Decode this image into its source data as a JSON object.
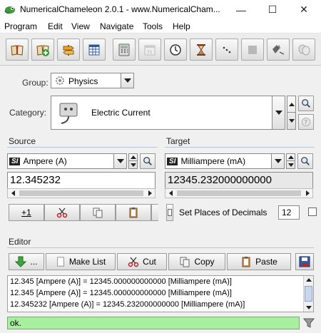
{
  "window": {
    "title": "NumericalChameleon 2.0.1 - www.NumericalCham...",
    "minimize_glyph": "—",
    "maximize_glyph": "☐",
    "close_glyph": "✕"
  },
  "menu": [
    "Program",
    "Edit",
    "View",
    "Navigate",
    "Tools",
    "Help"
  ],
  "toolbar": {
    "icons": [
      "book-icon",
      "add-book-icon",
      "signpost-icon",
      "table-icon",
      "calculator-icon",
      "calendar-icon",
      "clock-icon",
      "hourglass-icon",
      "dice-icon",
      "square-icon",
      "speech-icon",
      "masks-icon"
    ]
  },
  "group": {
    "label": "Group:",
    "value": "Physics"
  },
  "category": {
    "label": "Category:",
    "value": "Electric Current"
  },
  "source": {
    "title": "Source",
    "unit_badge": "SI",
    "unit": "Ampere (A)",
    "value": "12.345232"
  },
  "target": {
    "title": "Target",
    "unit_badge": "SI",
    "unit": "Milliampere (mA)",
    "value": "12345.232000000000"
  },
  "source_actions": {
    "increment_label": "+1"
  },
  "decimals": {
    "label": "Set Places of Decimals",
    "value": "12"
  },
  "editor": {
    "title": "Editor",
    "buttons": {
      "more_label": "...",
      "make_list": "Make List",
      "cut": "Cut",
      "copy": "Copy",
      "paste": "Paste"
    },
    "lines": [
      "12.345 [Ampere (A)] = 12345.000000000000 [Milliampere (mA)]",
      "12.345 [Ampere (A)] = 12345.000000000000 [Milliampere (mA)]",
      "12.345232 [Ampere (A)] = 12345.232000000000 [Milliampere (mA)]"
    ]
  },
  "status": {
    "text": "ok.",
    "color": "#a8f0a0"
  },
  "colors": {
    "section_line": "#b8c7d8",
    "target_bg": "#e8e8e8"
  }
}
